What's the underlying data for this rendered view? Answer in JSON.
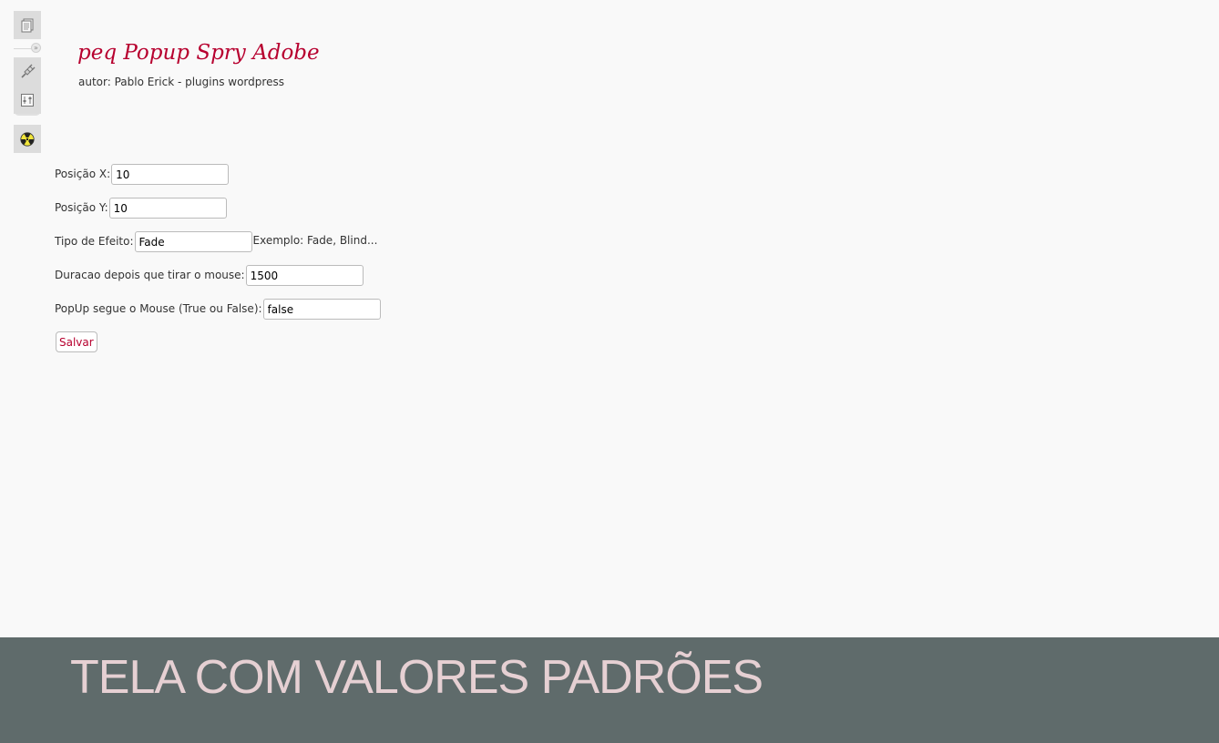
{
  "header": {
    "title": "peq Popup Spry Adobe",
    "author": "autor: Pablo Erick - plugins wordpress"
  },
  "rail": {
    "icons": [
      "posts-icon",
      "collapse-arrow-icon",
      "plugins-icon",
      "tools-icon",
      "radiation-icon"
    ]
  },
  "form": {
    "pos_x": {
      "label": "Posição X:",
      "value": "10"
    },
    "pos_y": {
      "label": "Posição Y:",
      "value": "10"
    },
    "effect": {
      "label": "Tipo de Efeito:",
      "value": "Fade",
      "hint": "Exemplo: Fade, Blind..."
    },
    "duration": {
      "label": "Duracao depois que tirar o mouse:",
      "value": "1500"
    },
    "follow_mouse": {
      "label": "PopUp segue o Mouse (True ou False):",
      "value": "false"
    },
    "save_label": "Salvar"
  },
  "banner": {
    "text": "TELA COM VALORES PADRÕES"
  },
  "colors": {
    "accent": "#b7002f",
    "background": "#f9f9f9",
    "banner_bg": "#5f6b6b",
    "banner_text": "#e6d0d3"
  }
}
